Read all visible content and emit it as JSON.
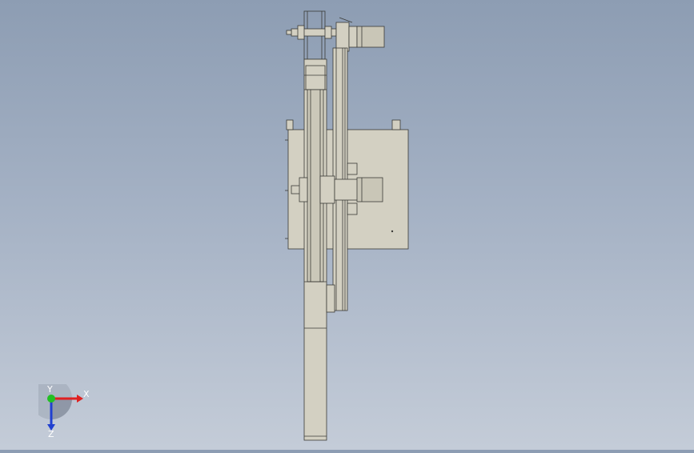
{
  "viewport": {
    "background_top": "#8d9db3",
    "background_bottom": "#c4ccd8",
    "part_fill": "#d3d0c2",
    "part_stroke": "#3a3a36"
  },
  "triad": {
    "x_label": "X",
    "y_label": "Y",
    "z_label": "Z",
    "x_color": "#e02020",
    "y_color": "#22c022",
    "z_color": "#2040d0"
  }
}
